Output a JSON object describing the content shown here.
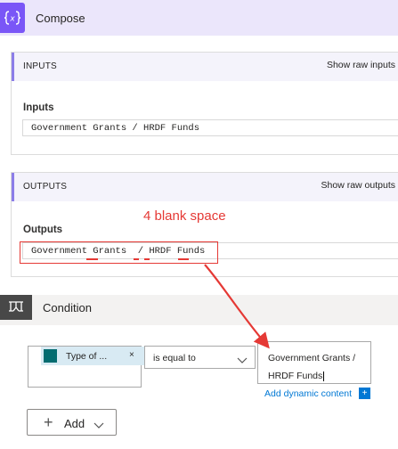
{
  "compose": {
    "title": "Compose",
    "icon": "curly-braces-icon",
    "accent": "#7a56f7"
  },
  "inputs": {
    "header": "INPUTS",
    "show_raw": "Show raw inputs",
    "label": "Inputs",
    "value": "Government Grants / HRDF Funds"
  },
  "outputs": {
    "header": "OUTPUTS",
    "show_raw": "Show raw outputs",
    "label": "Outputs",
    "value": "Government Grants  / HRDF Funds"
  },
  "annotation": {
    "text": "4 blank space",
    "color": "#e53935"
  },
  "condition": {
    "title": "Condition",
    "icon": "condition-icon",
    "left_operand": {
      "token_label": "Type of ...",
      "token_icon": "sharepoint-icon",
      "remove": "×"
    },
    "operator": "is equal to",
    "right_operand": {
      "line1": "Government Grants /",
      "line2": "HRDF Funds"
    },
    "add_dynamic_content": "Add dynamic content",
    "add_dynamic_plus": "+",
    "add_button": "Add"
  }
}
